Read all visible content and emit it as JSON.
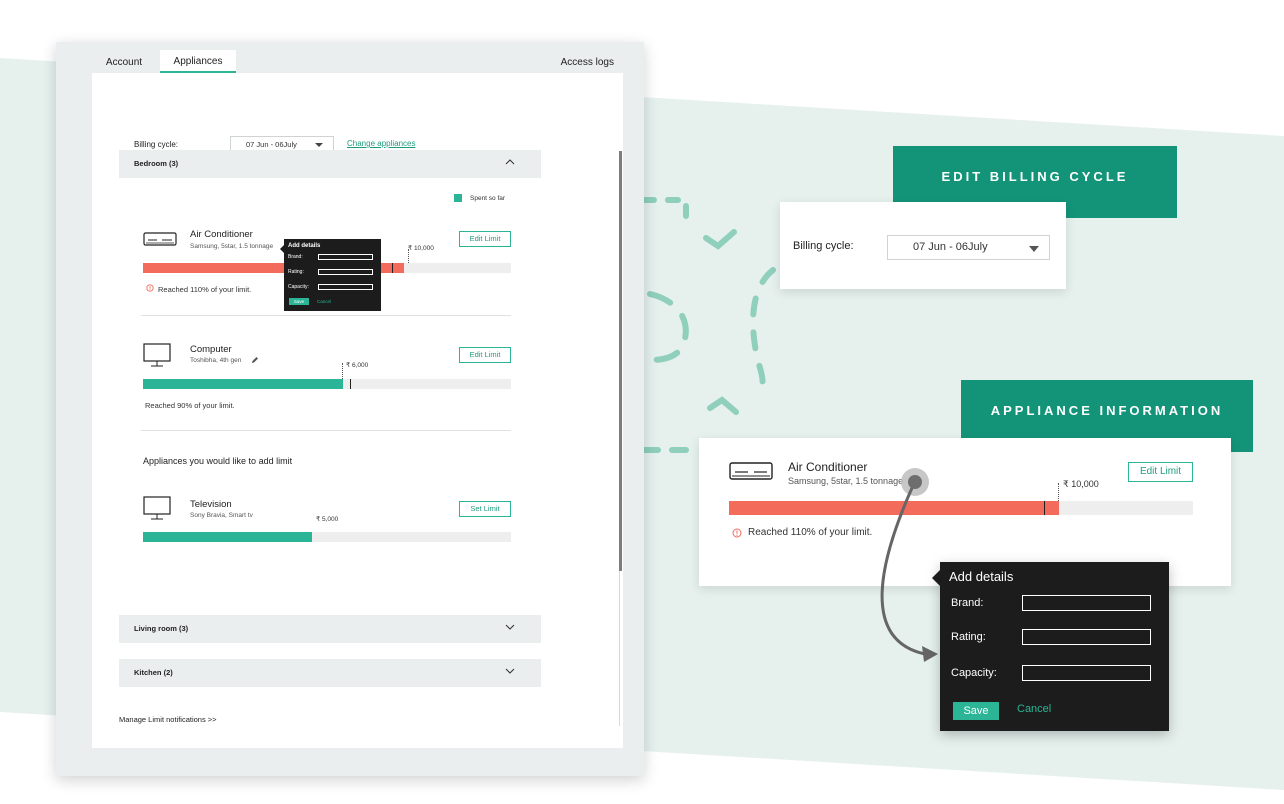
{
  "colors": {
    "accent": "#2bb596",
    "accent_dark": "#139478",
    "over_limit": "#f26b5b",
    "bg_band": "#e6f1ee",
    "popover_bg": "#1c1c1c"
  },
  "tabs": {
    "account": "Account",
    "appliances": "Appliances",
    "access_logs": "Access logs"
  },
  "billing": {
    "label": "Billing cycle:",
    "value": "07 Jun - 06July",
    "change_link": "Change appliances"
  },
  "rooms": [
    {
      "title": "Bedroom (3)",
      "expanded": true
    },
    {
      "title": "Living room (3)",
      "expanded": false
    },
    {
      "title": "Kitchen (2)",
      "expanded": false
    }
  ],
  "legend": {
    "label": "Spent so far"
  },
  "appliances": [
    {
      "name": "Air Conditioner",
      "details": "Samsung, 5star, 1.5 tonnage",
      "action": "Edit Limit",
      "limit": "₹ 10,000",
      "spent_fraction": 1.1,
      "note": "Reached 110% of your limit.",
      "icon": "air-conditioner-icon"
    },
    {
      "name": "Computer",
      "details": "Toshibha, 4th gen",
      "action": "Edit Limit",
      "limit": "₹ 6,000",
      "spent_fraction": 0.9,
      "note": "Reached 90% of your limit.",
      "icon": "monitor-icon"
    }
  ],
  "add_limit_section": {
    "title": "Appliances you would like to add limit",
    "items": [
      {
        "name": "Television",
        "details": "Sony Bravia, Smart tv",
        "action": "Set Limit",
        "limit": "₹ 5,000",
        "icon": "monitor-icon"
      }
    ]
  },
  "footer": {
    "link": "Manage Limit notifications  >>"
  },
  "popover": {
    "title": "Add details",
    "fields": [
      "Brand:",
      "Rating:",
      "Capacity:"
    ],
    "save": "Save",
    "cancel": "Cancel"
  },
  "callouts": {
    "billing_banner": "EDIT BILLING CYCLE",
    "appliance_banner": "APPLIANCE INFORMATION"
  }
}
